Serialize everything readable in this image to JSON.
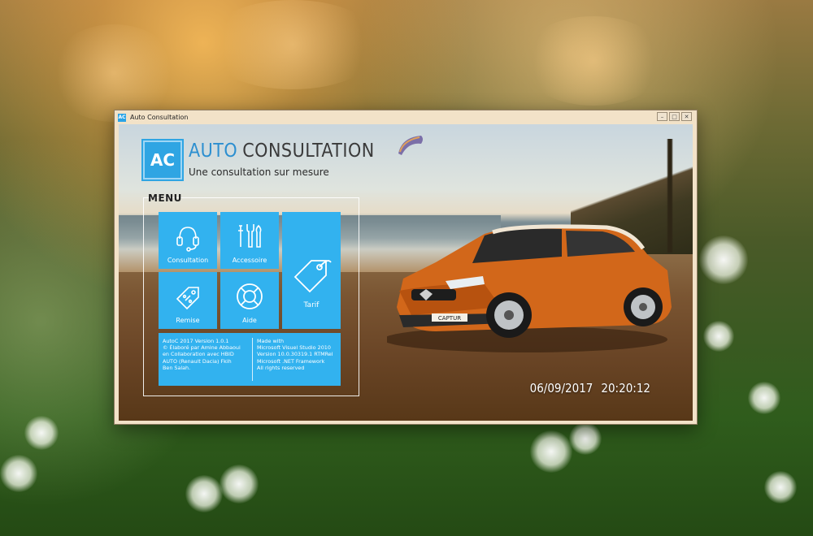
{
  "window": {
    "title": "Auto Consultation",
    "icon_name": "app-icon",
    "controls": [
      "minimize-icon",
      "maximize-icon",
      "close-icon"
    ]
  },
  "header": {
    "logo_text": "AC",
    "brand_part1": "AUTO",
    "brand_part2": "CONSULTATION",
    "tagline": "Une consultation sur mesure",
    "accent_color": "#2c8fd0"
  },
  "menu": {
    "title": "MENU",
    "tile_color": "#32b2ef",
    "tiles": [
      {
        "label": "Consultation",
        "icon": "headset-icon"
      },
      {
        "label": "Accessoire",
        "icon": "tools-icon"
      },
      {
        "label": "Tarif",
        "icon": "price-tag-icon"
      },
      {
        "label": "Remise",
        "icon": "discount-tag-icon"
      },
      {
        "label": "Aide",
        "icon": "lifebuoy-icon"
      }
    ]
  },
  "info": {
    "line1": "AutoC 2017  Version 1.0.1",
    "line2": "© Élaboré par Amine Abbaoui",
    "line3": "en Collaboration avec HBID",
    "line4": "AUTO (Renault Dacia)   Fkih",
    "line5": "Ben Salah.",
    "made1": "Made with",
    "made2": "Microsoft Visuel Studio 2010",
    "made3": "Version 10.0.30319.1 RTMRel",
    "made4": "Microsoft .NET Framework",
    "made5": "All rights reserved"
  },
  "car_plate": "CAPTUR",
  "datetime": {
    "date": "06/09/2017",
    "time": "20:20:12"
  }
}
